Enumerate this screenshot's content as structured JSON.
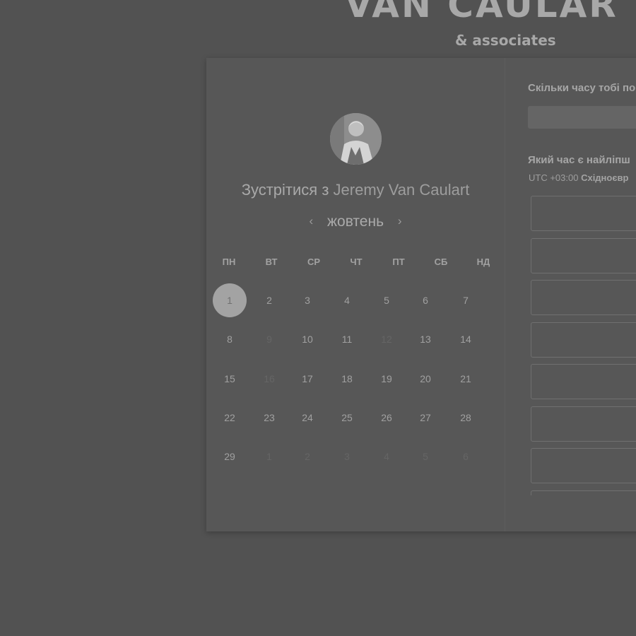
{
  "brand": {
    "name": "VAN CAULAR",
    "tagline": "& associates"
  },
  "scheduler": {
    "title_prefix": "Зустрітися з",
    "host_name": "Jeremy Van Caulart",
    "month": "жовтень",
    "prev_icon": "chevron-left-icon",
    "next_icon": "chevron-right-icon",
    "weekdays": [
      "ПН",
      "ВТ",
      "СР",
      "ЧТ",
      "ПТ",
      "СБ",
      "НД"
    ],
    "weeks": [
      [
        "1",
        "2",
        "3",
        "4",
        "5",
        "6",
        "7"
      ],
      [
        "8",
        "9",
        "10",
        "11",
        "12",
        "13",
        "14"
      ],
      [
        "15",
        "16",
        "17",
        "18",
        "19",
        "20",
        "21"
      ],
      [
        "22",
        "23",
        "24",
        "25",
        "26",
        "27",
        "28"
      ],
      [
        "29",
        "1",
        "2",
        "3",
        "4",
        "5",
        "6"
      ]
    ],
    "selected_day": "1",
    "unavailable_days": [
      "9",
      "12",
      "16"
    ]
  },
  "booking": {
    "duration_question": "Скільки часу тобі по",
    "time_question": "Який час є найліпш",
    "timezone_offset": "UTC +03:00",
    "timezone_name": "Східноєвр",
    "visible_slot_count": 8
  },
  "colors": {
    "overlay_background": "#525252",
    "card_background": "#575757",
    "selected_day_background": "#a3a3a3"
  }
}
